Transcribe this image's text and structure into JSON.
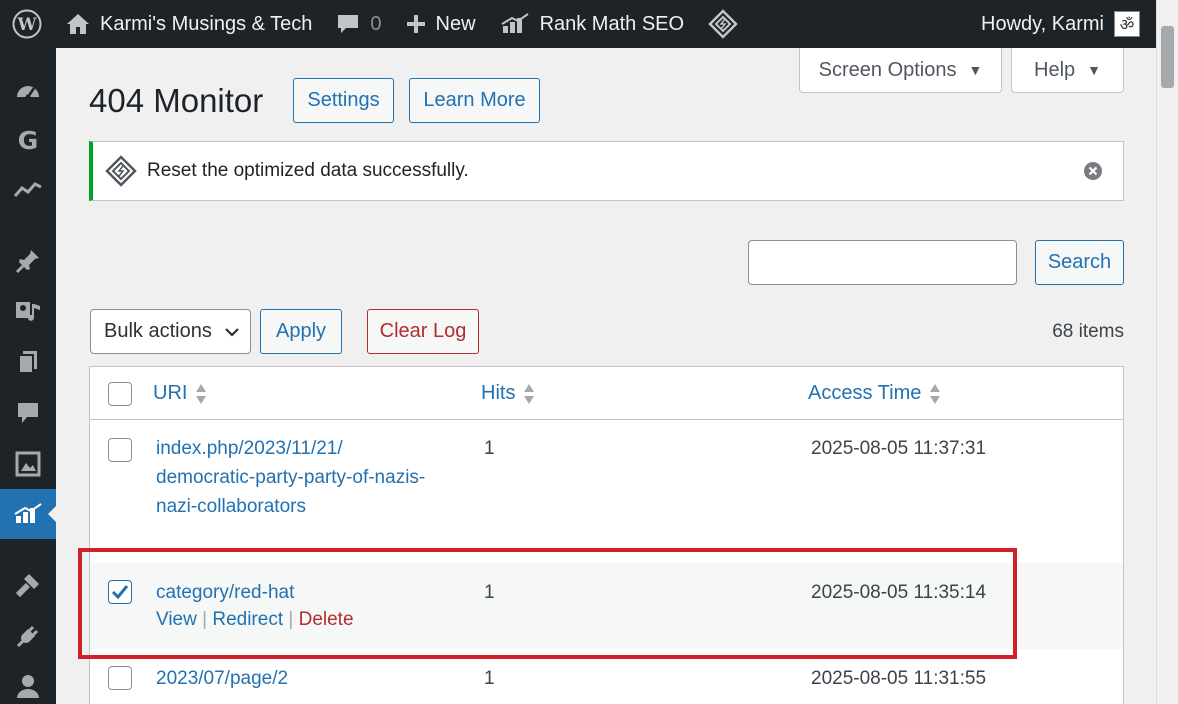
{
  "admin_bar": {
    "site_name": "Karmi's Musings & Tech",
    "comments_count": "0",
    "new_label": "New",
    "seo_label": "Rank Math SEO",
    "greeting": "Howdy, Karmi",
    "avatar_glyph": "ॐ"
  },
  "side_menu": {
    "icons": [
      "dashboard-icon",
      "google-site-kit-icon",
      "analytics-icon",
      "posts-pin-icon",
      "media-icon",
      "pages-icon",
      "comments-icon",
      "gallery-icon",
      "rank-math-icon",
      "appearance-icon",
      "plugins-icon",
      "users-icon"
    ],
    "current": "rank-math-icon"
  },
  "screen_meta": {
    "screen_options_label": "Screen Options",
    "help_label": "Help"
  },
  "page": {
    "title": "404 Monitor",
    "settings_label": "Settings",
    "learn_more_label": "Learn More"
  },
  "notice": {
    "message": "Reset the optimized data successfully.",
    "accent_color": "#00a32a"
  },
  "search": {
    "value": "",
    "button_label": "Search"
  },
  "tablenav": {
    "bulk_actions_label": "Bulk actions",
    "apply_label": "Apply",
    "clear_log_label": "Clear Log",
    "items_count": "68 items"
  },
  "table": {
    "columns": {
      "uri": "URI",
      "hits": "Hits",
      "access_time": "Access Time"
    },
    "rows": [
      {
        "uri_lines": [
          "index.php/2023/11/21/",
          "democratic-party-party-of-nazis-",
          "nazi-collaborators"
        ],
        "hits": "1",
        "access_time": "2025-08-05 11:37:31",
        "checked": false
      },
      {
        "uri_lines": [
          "category/red-hat"
        ],
        "hits": "1",
        "access_time": "2025-08-05 11:35:14",
        "checked": true,
        "actions": {
          "view": "View",
          "separator": "|",
          "redirect": "Redirect",
          "delete": "Delete"
        }
      },
      {
        "uri_lines": [
          "2023/07/page/2"
        ],
        "hits": "1",
        "access_time": "2025-08-05 11:31:55",
        "checked": false
      }
    ]
  },
  "colors": {
    "primary": "#2271b1",
    "danger": "#b32d2e",
    "admin_bar": "#1d2327",
    "highlight": "#d0212a"
  }
}
